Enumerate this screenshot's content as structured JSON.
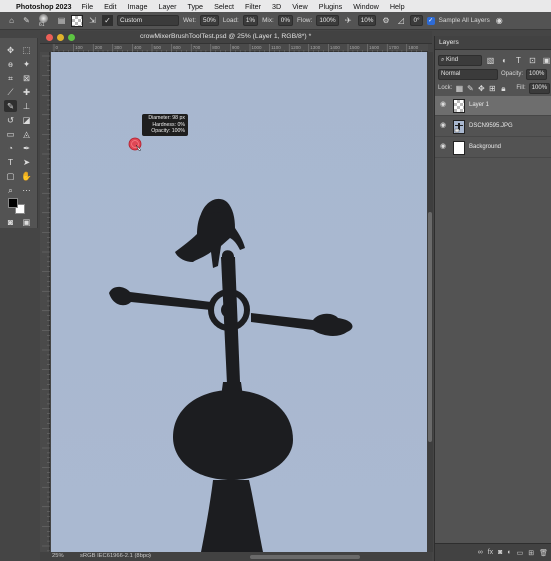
{
  "menubar": {
    "app_name": "Photoshop 2023",
    "items": [
      "File",
      "Edit",
      "Image",
      "Layer",
      "Type",
      "Select",
      "Filter",
      "3D",
      "View",
      "Plugins",
      "Window",
      "Help"
    ]
  },
  "options_bar": {
    "brush_size": "61",
    "preset": "Custom",
    "wet_label": "Wet:",
    "wet_value": "50%",
    "load_label": "Load:",
    "load_value": "1%",
    "mix_label": "Mix:",
    "mix_value": "0%",
    "flow_label": "Flow:",
    "flow_value": "100%",
    "smoothing_value": "10%",
    "angle_value": "0°",
    "sample_all_layers": "Sample All Layers"
  },
  "document": {
    "title": "crowMixerBrushToolTest.psd @ 25% (Layer 1, RGB/8*) *",
    "zoom": "25%",
    "profile": "sRGB IEC61966-2.1 (8bpc)"
  },
  "ruler": {
    "h_labels": [
      "0",
      "100",
      "200",
      "300",
      "400",
      "500",
      "600",
      "700",
      "800",
      "900",
      "1000",
      "1100",
      "1200",
      "1300",
      "1400",
      "1500",
      "1600",
      "1700",
      "1800"
    ]
  },
  "brush_tooltip": {
    "diameter": "Diameter:  98 px",
    "hardness": "Hardness:      0%",
    "opacity": "Opacity:  100%"
  },
  "layers_panel": {
    "tab_label": "Layers",
    "filter_kind": "Kind",
    "blend_mode": "Normal",
    "opacity_label": "Opacity:",
    "opacity_value": "100%",
    "lock_label": "Lock:",
    "fill_label": "Fill:",
    "fill_value": "100%",
    "layers": [
      {
        "name": "Layer 1",
        "selected": true
      },
      {
        "name": "DSCN9595.JPG",
        "selected": false
      },
      {
        "name": "Background",
        "selected": false
      }
    ]
  },
  "colors": {
    "sky": "#a9b8d0",
    "silhouette": "#1c1d20",
    "panel": "#535353",
    "brush_cursor": "#e8343f"
  }
}
